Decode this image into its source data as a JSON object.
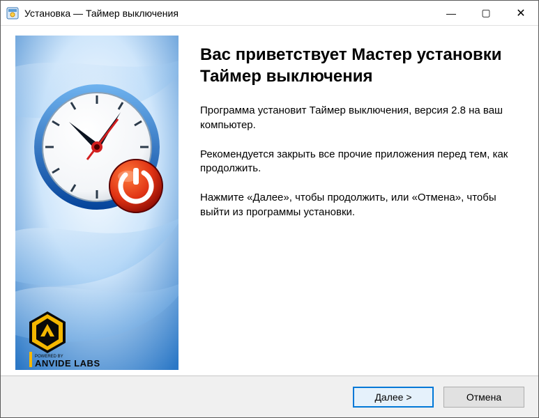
{
  "titlebar": {
    "title": "Установка — Таймер выключения"
  },
  "main": {
    "heading": "Вас приветствует Мастер установки Таймер выключения",
    "p1": "Программа установит Таймер выключения, версия 2.8 на ваш компьютер.",
    "p2": "Рекомендуется закрыть все прочие приложения перед тем, как продолжить.",
    "p3": "Нажмите «Далее», чтобы продолжить, или «Отмена», чтобы выйти из программы установки."
  },
  "footer": {
    "next_label": "Далее >",
    "cancel_label": "Отмена"
  },
  "brand": {
    "name": "ANVIDE LABS",
    "tagline": "POWERED BY"
  },
  "icons": {
    "app_icon": "installer-icon",
    "minimize": "—",
    "maximize": "▢",
    "close": "✕"
  },
  "colors": {
    "accent": "#0078d7",
    "footer_bg": "#f0f0f0"
  }
}
